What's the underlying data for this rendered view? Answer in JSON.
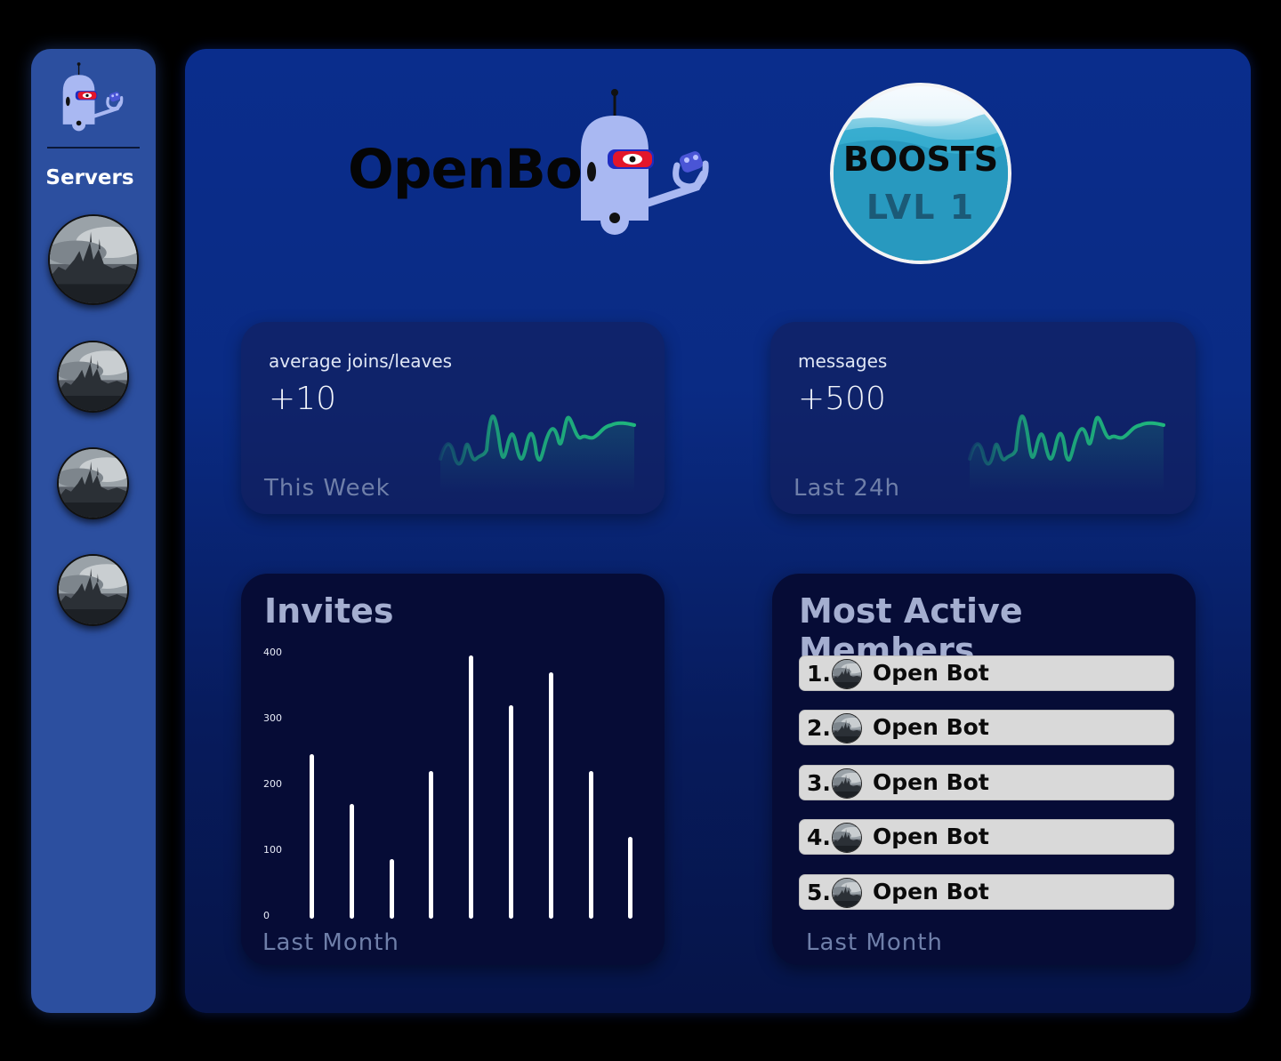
{
  "sidebar": {
    "servers_label": "Servers",
    "servers": [
      {
        "icon": "server-avatar-icon"
      },
      {
        "icon": "server-avatar-icon"
      },
      {
        "icon": "server-avatar-icon"
      },
      {
        "icon": "server-avatar-icon"
      }
    ]
  },
  "header": {
    "brand": "OpenBot",
    "boosts_title": "BOOSTS",
    "boosts_level": "LVL 1"
  },
  "stats": [
    {
      "label": "average joins/leaves",
      "value": "+10",
      "period": "This Week"
    },
    {
      "label": "messages",
      "value": "+500",
      "period": "Last 24h"
    }
  ],
  "invites": {
    "title": "Invites",
    "period": "Last Month"
  },
  "chart_data": {
    "type": "bar",
    "title": "Invites",
    "xlabel": "",
    "ylabel": "",
    "ylim": [
      0,
      400
    ],
    "yticks": [
      "0",
      "100",
      "200",
      "300",
      "400"
    ],
    "values": [
      250,
      175,
      90,
      225,
      400,
      325,
      375,
      225,
      125
    ]
  },
  "members": {
    "title": "Most Active Members",
    "period": "Last Month",
    "items": [
      {
        "rank": "1.",
        "name": "Open Bot"
      },
      {
        "rank": "2.",
        "name": "Open Bot"
      },
      {
        "rank": "3.",
        "name": "Open Bot"
      },
      {
        "rank": "4.",
        "name": "Open Bot"
      },
      {
        "rank": "5.",
        "name": "Open Bot"
      }
    ]
  },
  "colors": {
    "sidebar": "#2c4f9f",
    "main": "#0a2d8c",
    "spark": "#1fb67d",
    "panel": "#060c36"
  }
}
